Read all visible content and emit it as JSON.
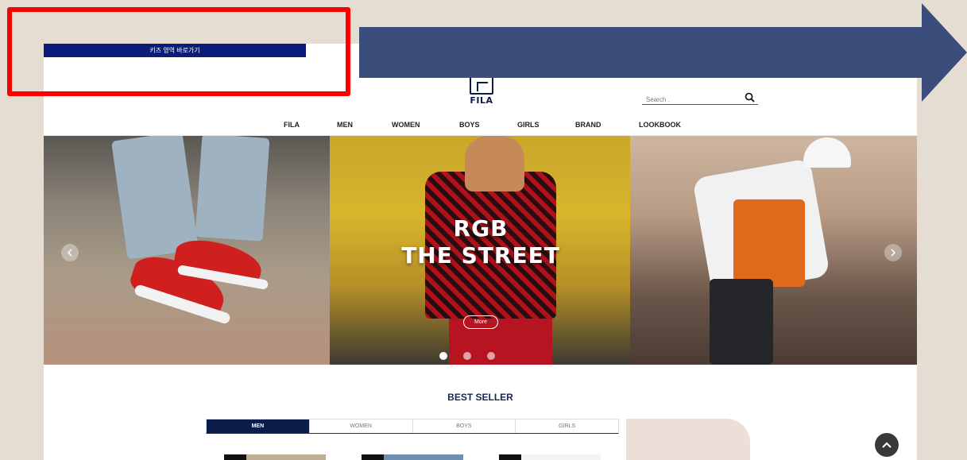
{
  "skip_link": {
    "label": "키즈 영역 바로가기"
  },
  "header": {
    "logo_text": "FILA",
    "search": {
      "placeholder": "Search ."
    }
  },
  "nav": {
    "items": [
      {
        "label": "FILA"
      },
      {
        "label": "MEN"
      },
      {
        "label": "WOMEN"
      },
      {
        "label": "BOYS"
      },
      {
        "label": "GIRLS"
      },
      {
        "label": "BRAND"
      },
      {
        "label": "LOOKBOOK"
      }
    ]
  },
  "banner": {
    "headline_line1": "RGB",
    "headline_line2": "THE STREET",
    "more_label": "More",
    "slide_count": 3,
    "active_slide": 1
  },
  "best_seller": {
    "title": "BEST SELLER",
    "tabs": [
      {
        "label": "MEN"
      },
      {
        "label": "WOMEN"
      },
      {
        "label": "BOYS"
      },
      {
        "label": "GIRLS"
      }
    ],
    "active_tab": 0
  },
  "colors": {
    "background": "#e6ddd2",
    "skip_bar": "#0b1c7a",
    "brand_navy": "#0b1c4a",
    "highlight_frame": "#ff0000",
    "annotation_arrow": "#3b4d7a"
  },
  "icons": {
    "search": "search-icon",
    "prev": "chevron-left-icon",
    "next": "chevron-right-icon",
    "scroll_top": "chevron-up-icon"
  }
}
